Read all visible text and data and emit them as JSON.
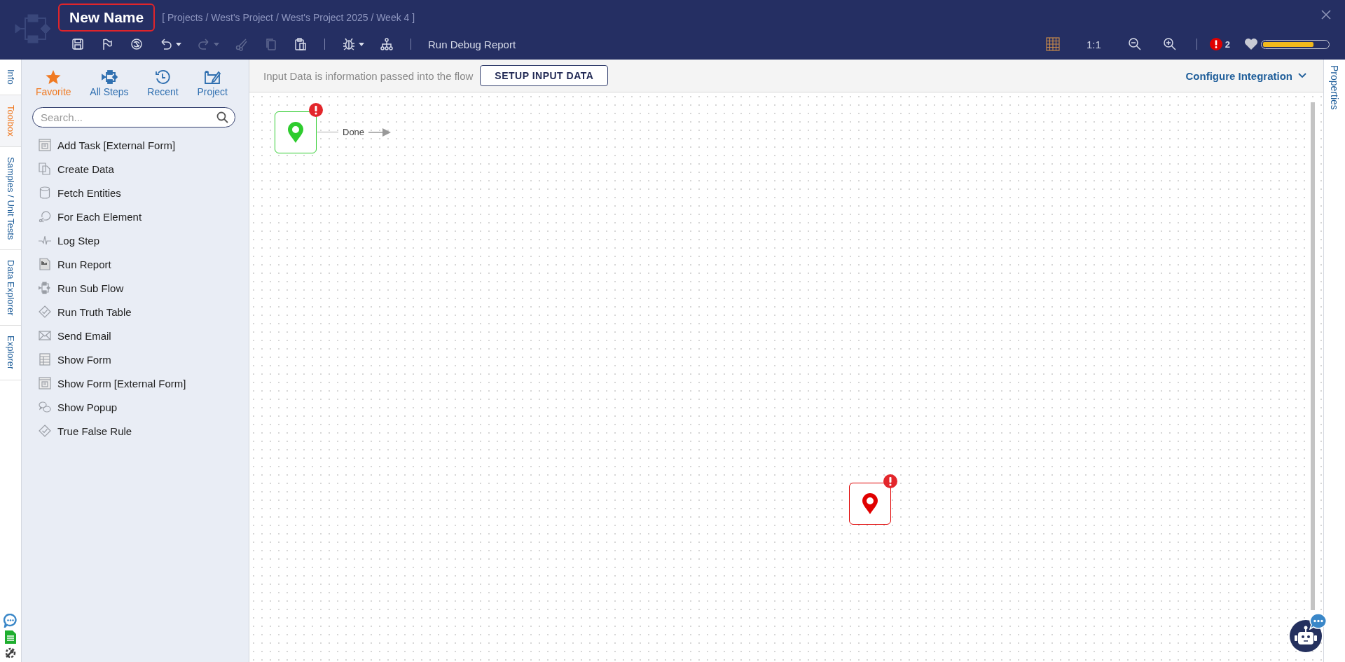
{
  "header": {
    "title": "New Name",
    "breadcrumb": "[ Projects / West's Project / West's Project 2025 / Week 4 ]",
    "toolbar": [
      {
        "kind": "save",
        "disabled": false,
        "menu": false
      },
      {
        "kind": "flag",
        "disabled": false,
        "menu": false
      },
      {
        "kind": "swirl",
        "disabled": false,
        "menu": false
      },
      {
        "kind": "undo",
        "disabled": false,
        "menu": true
      },
      {
        "kind": "redo",
        "disabled": true,
        "menu": true
      },
      {
        "kind": "cut",
        "disabled": true,
        "menu": false
      },
      {
        "kind": "copy",
        "disabled": true,
        "menu": false
      },
      {
        "kind": "paste",
        "disabled": false,
        "menu": false
      },
      {
        "kind": "bug",
        "disabled": false,
        "menu": true
      },
      {
        "kind": "tree",
        "disabled": false,
        "menu": false
      }
    ],
    "debug_report": "Run Debug Report",
    "zoom_reset": "1:1",
    "error_count": "2",
    "health": {
      "level": 0.78
    }
  },
  "side_tabs": [
    {
      "label": "Info",
      "selected": false
    },
    {
      "label": "Toolbox",
      "selected": true
    },
    {
      "label": "Samples / Unit Tests",
      "selected": false
    },
    {
      "label": "Data Explorer",
      "selected": false
    },
    {
      "label": "Explorer",
      "selected": false
    }
  ],
  "toolbox": {
    "tabs": [
      {
        "label": "Favorite",
        "kind": "star",
        "selected": true
      },
      {
        "label": "All Steps",
        "kind": "steps",
        "selected": false
      },
      {
        "label": "Recent",
        "kind": "clock",
        "selected": false
      },
      {
        "label": "Project",
        "kind": "project",
        "selected": false
      }
    ],
    "search": {
      "placeholder": "Search..."
    },
    "items": [
      {
        "label": "Add Task [External Form]",
        "kind": "form"
      },
      {
        "label": "Create Data",
        "kind": "copy"
      },
      {
        "label": "Fetch Entities",
        "kind": "database"
      },
      {
        "label": "For Each Element",
        "kind": "loop"
      },
      {
        "label": "Log Step",
        "kind": "pulse"
      },
      {
        "label": "Run Report",
        "kind": "report"
      },
      {
        "label": "Run Sub Flow",
        "kind": "subflow"
      },
      {
        "label": "Run Truth Table",
        "kind": "check"
      },
      {
        "label": "Send Email",
        "kind": "mail"
      },
      {
        "label": "Show Form",
        "kind": "table"
      },
      {
        "label": "Show Form [External Form]",
        "kind": "form"
      },
      {
        "label": "Show Popup",
        "kind": "chat"
      },
      {
        "label": "True False Rule",
        "kind": "check"
      }
    ]
  },
  "input_bar": {
    "text": "Input Data is information passed into the flow",
    "button": "SETUP INPUT DATA",
    "configure": "Configure Integration"
  },
  "properties_tab": "Properties",
  "canvas": {
    "nodes": [
      {
        "kind": "start",
        "error": true
      },
      {
        "kind": "end",
        "error": true
      }
    ],
    "connector": "Done"
  }
}
